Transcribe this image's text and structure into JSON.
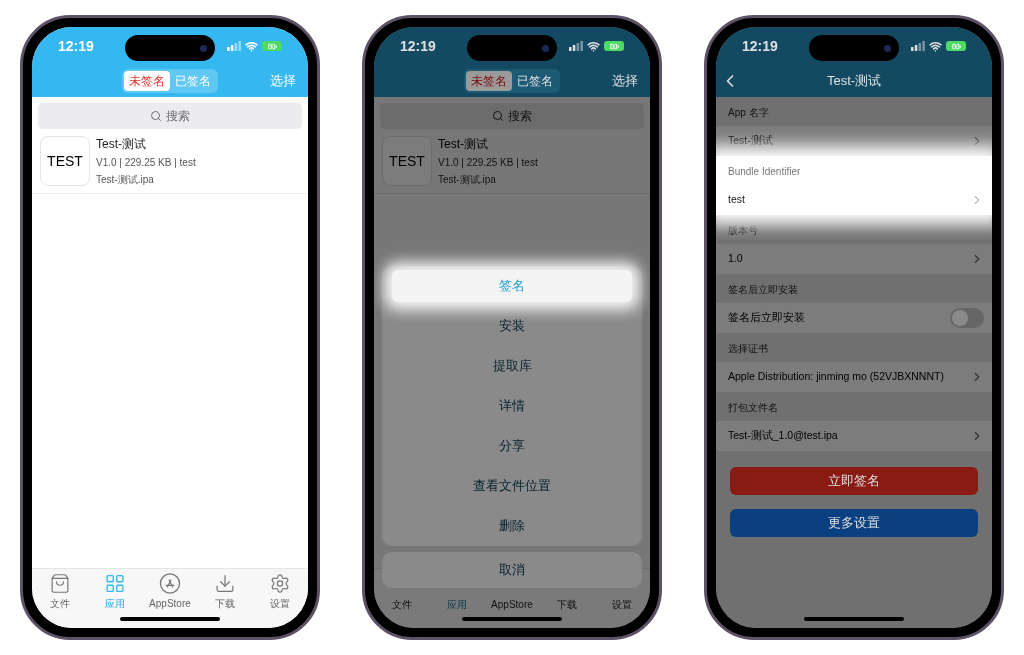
{
  "phones": [
    {
      "kind": "list",
      "dimmed": false,
      "status": {
        "time": "12:19"
      },
      "segments": [
        {
          "label": "未签名",
          "selected": true
        },
        {
          "label": "已签名",
          "selected": false
        }
      ],
      "nav_action": "选择",
      "search": {
        "placeholder": "搜索"
      },
      "apps": [
        {
          "icon_text": "TEST",
          "name": "Test-测试",
          "meta": "V1.0 | 229.25 KB | test",
          "file": "Test-测试.ipa"
        }
      ],
      "tabs": [
        {
          "label": "文件",
          "selected": false
        },
        {
          "label": "应用",
          "selected": true
        },
        {
          "label": "AppStore",
          "selected": false
        },
        {
          "label": "下载",
          "selected": false
        },
        {
          "label": "设置",
          "selected": false
        }
      ]
    },
    {
      "kind": "list",
      "dimmed": true,
      "status": {
        "time": "12:19"
      },
      "segments": [
        {
          "label": "未签名",
          "selected": true
        },
        {
          "label": "已签名",
          "selected": false
        }
      ],
      "nav_action": "选择",
      "search": {
        "placeholder": "搜索"
      },
      "apps": [
        {
          "icon_text": "TEST",
          "name": "Test-测试",
          "meta": "V1.0 | 229.25 KB | test",
          "file": "Test-测试.ipa"
        }
      ],
      "tabs": [
        {
          "label": "文件",
          "selected": false
        },
        {
          "label": "应用",
          "selected": true
        },
        {
          "label": "AppStore",
          "selected": false
        },
        {
          "label": "下载",
          "selected": false
        },
        {
          "label": "设置",
          "selected": false
        }
      ],
      "action_sheet": {
        "items": [
          {
            "label": "签名",
            "highlighted": true
          },
          {
            "label": "安装",
            "highlighted": false
          },
          {
            "label": "提取库",
            "highlighted": false
          },
          {
            "label": "详情",
            "highlighted": false
          },
          {
            "label": "分享",
            "highlighted": false
          },
          {
            "label": "查看文件位置",
            "highlighted": false
          },
          {
            "label": "删除",
            "highlighted": false
          }
        ],
        "cancel": "取消"
      }
    },
    {
      "kind": "detail",
      "dimmed": true,
      "status": {
        "time": "12:19"
      },
      "title": "Test-测试",
      "sections": [
        {
          "header": "App 名字",
          "kind": "link",
          "value": "Test-测试",
          "highlighted": false
        },
        {
          "header": "Bundle Identifier",
          "kind": "link",
          "value": "test",
          "highlighted": true
        },
        {
          "header": "版本号",
          "kind": "link",
          "value": "1.0",
          "highlighted": false
        },
        {
          "header": "签名后立即安装",
          "kind": "switch",
          "value": "签名后立即安装",
          "on": false,
          "highlighted": false
        },
        {
          "header": "选择证书",
          "kind": "link",
          "value": "Apple Distribution: jinming mo (52VJBXNNNT)",
          "highlighted": false
        },
        {
          "header": "打包文件名",
          "kind": "link",
          "value": "Test-测试_1.0@test.ipa",
          "highlighted": false
        }
      ],
      "buttons": [
        {
          "label": "立即签名",
          "kind": "danger"
        },
        {
          "label": "更多设置",
          "kind": "primary"
        }
      ]
    }
  ]
}
